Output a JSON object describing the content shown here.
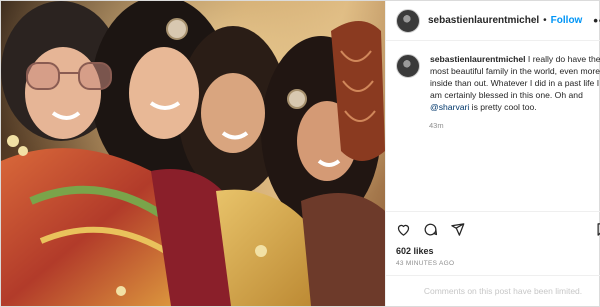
{
  "post": {
    "username": "sebastienlaurentmichel",
    "separator": "•",
    "follow_label": "Follow",
    "more_label": "•••",
    "caption_username": "sebastienlaurentmichel",
    "caption_text_1": " I really do have the most beautiful family in the world, even more inside than out. Whatever I did in a past life I am certainly blessed in this one. Oh and ",
    "caption_mention": "@sharvari",
    "caption_text_2": " is pretty cool too.",
    "caption_time": "43m",
    "likes": "602 likes",
    "posted_ago": "43 MINUTES AGO",
    "comments_limited": "Comments on this post have been limited."
  },
  "icons": {
    "like": "heart-icon",
    "comment": "comment-icon",
    "share": "share-icon",
    "save": "bookmark-icon",
    "more": "more-icon"
  },
  "colors": {
    "accent": "#0095f6",
    "text": "#262626",
    "muted": "#8e8e8e",
    "disabled": "#c7c7c7",
    "border": "#efefef"
  }
}
